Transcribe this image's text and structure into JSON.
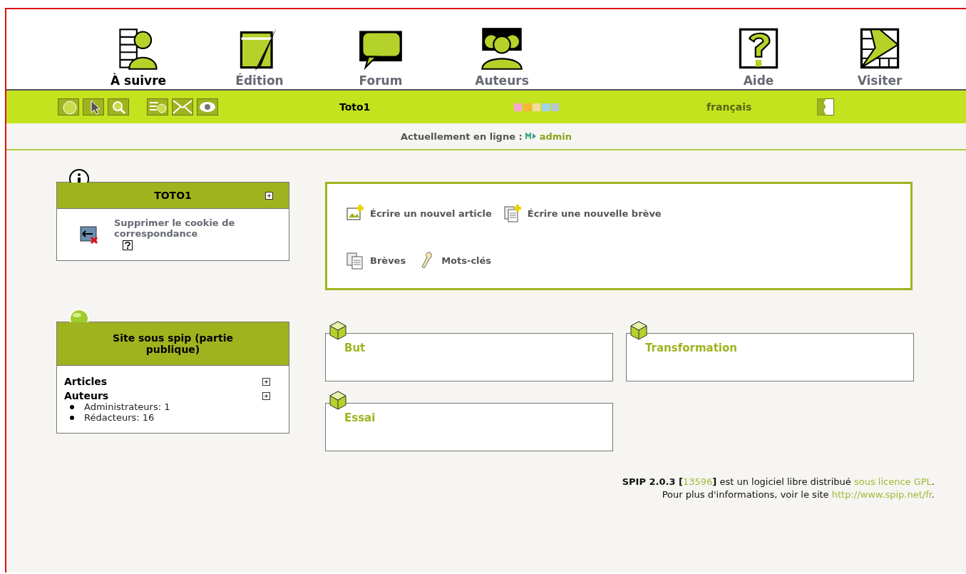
{
  "nav": [
    {
      "label": "À suivre",
      "selected": true
    },
    {
      "label": "Édition",
      "selected": false
    },
    {
      "label": "Forum",
      "selected": false
    },
    {
      "label": "Auteurs",
      "selected": false
    },
    {
      "label": "Aide",
      "selected": false
    },
    {
      "label": "Visiter",
      "selected": false
    }
  ],
  "toolbar": {
    "user": "Toto1",
    "swatches": [
      {
        "color": "#f7a8d8"
      },
      {
        "color": "#f9b23a"
      },
      {
        "color": "#f5d9a0"
      },
      {
        "color": "#9fd3ee"
      },
      {
        "color": "#b8c4d8"
      }
    ],
    "language": "français"
  },
  "online": {
    "label": "Actuellement en ligne :",
    "user": "admin"
  },
  "info_box": {
    "title": "TOTO1",
    "action": "Supprimer le cookie de correspondance"
  },
  "actions": [
    {
      "label": "Écrire un nouvel article"
    },
    {
      "label": "Écrire une nouvelle brève"
    },
    {
      "label": "Brèves"
    },
    {
      "label": "Mots-clés"
    }
  ],
  "site_box": {
    "title": "Site sous spip (partie publique)",
    "sections": [
      {
        "label": "Articles"
      },
      {
        "label": "Auteurs",
        "items": [
          "Administrateurs: 1",
          "Rédacteurs: 16"
        ]
      }
    ]
  },
  "rubriques": [
    "But",
    "Transformation",
    "Essai"
  ],
  "footer": {
    "lines": [
      [
        {
          "kind": "bold",
          "text": "SPIP 2.0.3 ["
        },
        {
          "kind": "link",
          "text": "13596"
        },
        {
          "kind": "bold",
          "text": "]"
        },
        {
          "kind": "plain",
          "text": " est un logiciel libre distribué "
        },
        {
          "kind": "link",
          "text": "sous licence GPL"
        },
        {
          "kind": "plain",
          "text": "."
        }
      ],
      [
        {
          "kind": "plain",
          "text": "Pour plus d'informations, voir le site "
        },
        {
          "kind": "link",
          "text": "http://www.spip.net/fr"
        },
        {
          "kind": "plain",
          "text": "."
        }
      ]
    ]
  }
}
